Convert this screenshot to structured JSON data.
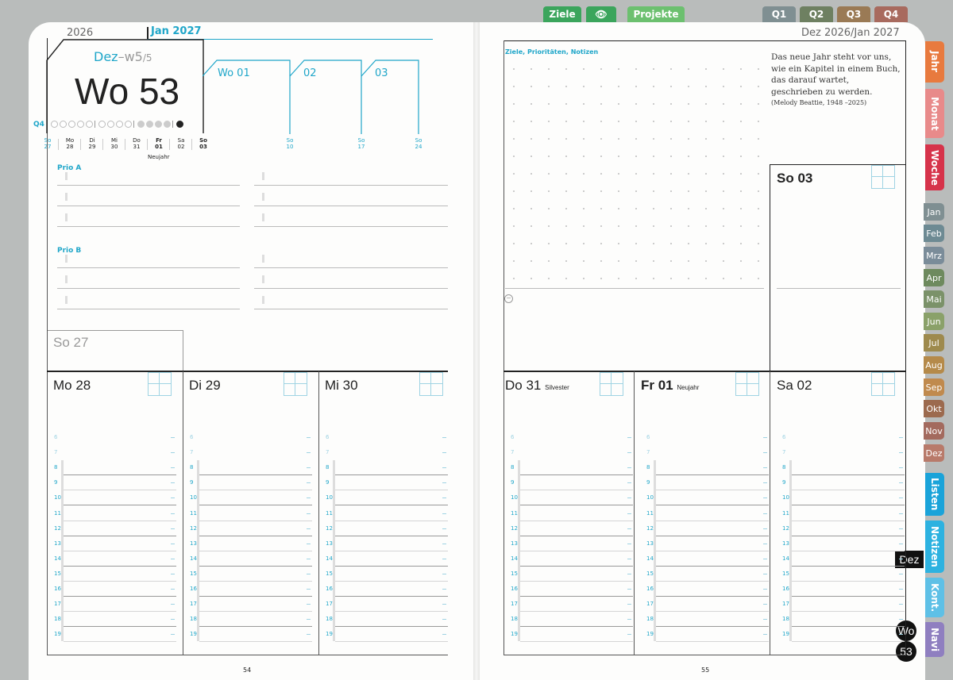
{
  "top_tabs": [
    {
      "label": "Ziele",
      "color": "#3ba55c"
    },
    {
      "label": "👁",
      "color": "#3ba55c"
    },
    {
      "label": "Projekte",
      "color": "#6cc06f"
    },
    {
      "label": "Q1",
      "color": "#7f8f92"
    },
    {
      "label": "Q2",
      "color": "#6e8061"
    },
    {
      "label": "Q3",
      "color": "#9a7a55"
    },
    {
      "label": "Q4",
      "color": "#a86a5e"
    }
  ],
  "side_tabs": [
    {
      "label": "Jahr",
      "color": "#e87a3e"
    },
    {
      "label": "Monat",
      "color": "#e88a8a"
    },
    {
      "label": "Woche",
      "color": "#d6334a"
    },
    {
      "label": "Jan",
      "color": "#7f8f92"
    },
    {
      "label": "Feb",
      "color": "#6d8a93"
    },
    {
      "label": "Mrz",
      "color": "#7a8c99"
    },
    {
      "label": "Apr",
      "color": "#6e8a5e"
    },
    {
      "label": "Mai",
      "color": "#7b9269"
    },
    {
      "label": "Jun",
      "color": "#8aa169"
    },
    {
      "label": "Jul",
      "color": "#9e8a4d"
    },
    {
      "label": "Aug",
      "color": "#b58a4a"
    },
    {
      "label": "Sep",
      "color": "#c08a4e"
    },
    {
      "label": "Okt",
      "color": "#9c6a4e"
    },
    {
      "label": "Nov",
      "color": "#a36a5e"
    },
    {
      "label": "Dez",
      "color": "#b87a6a"
    },
    {
      "label": "Listen",
      "color": "#1aa3d9"
    },
    {
      "label": "Notizen",
      "color": "#2db2e0"
    },
    {
      "label": "Kont.",
      "color": "#5ec0e6"
    },
    {
      "label": "Navi",
      "color": "#8f7fc0"
    }
  ],
  "left": {
    "year": "2026",
    "month_label": "Jan 2027",
    "week_box_month": "Dez",
    "week_box_sep": "–",
    "week_box_w": "w5",
    "week_box_of": "/5",
    "week_title": "Wo 53",
    "quarter": "Q4",
    "weeks": [
      "Wo 01",
      "02",
      "03"
    ],
    "cal": [
      {
        "d": "So",
        "n": "27"
      },
      {
        "d": "Mo",
        "n": "28"
      },
      {
        "d": "Di",
        "n": "29"
      },
      {
        "d": "Mi",
        "n": "30"
      },
      {
        "d": "Do",
        "n": "31"
      },
      {
        "d": "Fr",
        "n": "01"
      },
      {
        "d": "Sa",
        "n": "02"
      },
      {
        "d": "So",
        "n": "03"
      }
    ],
    "cal_more": [
      {
        "d": "So",
        "n": "10"
      },
      {
        "d": "So",
        "n": "17"
      },
      {
        "d": "So",
        "n": "24"
      }
    ],
    "holiday": "Neujahr",
    "prio_a": "Prio A",
    "prio_b": "Prio B",
    "sunday_prev": "So 27",
    "days": [
      "Mo 28",
      "Di 29",
      "Mi 30"
    ],
    "page_number": "54"
  },
  "right": {
    "header": "Dez 2026/Jan 2027",
    "notes_label": "Ziele, Prioritäten, Notizen",
    "quote_lines": [
      "Das neue Jahr steht vor uns,",
      "wie ein Kapitel in einem Buch,",
      "das darauf wartet,",
      "geschrieben zu werden."
    ],
    "quote_author": "(Melody Beattie, 1948 –2025)",
    "sunday": "So 03",
    "days": [
      {
        "label": "Do 31",
        "note": "Silvester",
        "bold": false
      },
      {
        "label": "Fr 01",
        "note": "Neujahr",
        "bold": true
      },
      {
        "label": "Sa 02",
        "note": "",
        "bold": false
      }
    ],
    "page_number": "55"
  },
  "hours": [
    "6",
    "7",
    "8",
    "9",
    "10",
    "11",
    "12",
    "13",
    "14",
    "15",
    "16",
    "17",
    "18",
    "19"
  ],
  "badge_month": "Dez",
  "badge_wo": "Wo",
  "badge_num": "53"
}
